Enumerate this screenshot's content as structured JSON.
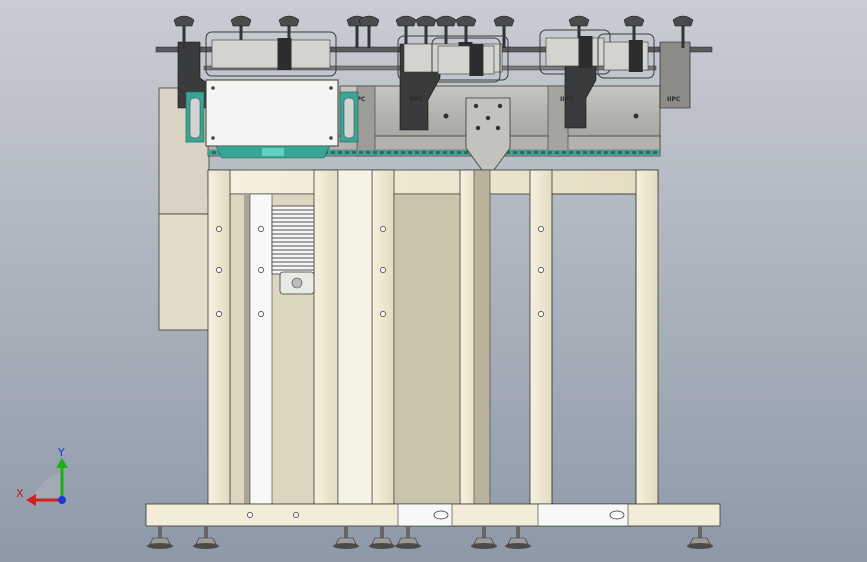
{
  "viewport": {
    "background_top": "#c9ccd3",
    "background_bottom": "#8e99a8"
  },
  "model": {
    "colors": {
      "frame": "#f0ead6",
      "frame_shadow": "#bdb6a0",
      "frame_edge": "#3a3a36",
      "steel": "#b9b9b6",
      "steel_dark": "#777774",
      "clamp": "#3a3b3d",
      "teal_belt": "#3aa594",
      "motor": "#f4f4f2"
    },
    "housing_labels": [
      "IIPC",
      "IIPC",
      "IIPC",
      "IIPC"
    ]
  },
  "triad": {
    "x_label": "X",
    "y_label": "Y",
    "x_color": "#d42020",
    "y_color": "#18b118",
    "z_color": "#1f37d6"
  }
}
